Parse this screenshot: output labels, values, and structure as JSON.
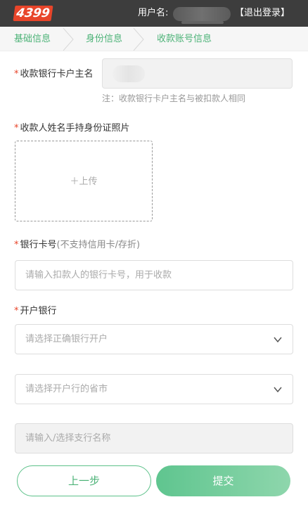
{
  "header": {
    "logo": "4399",
    "user_label": "用户名:",
    "logout": "【退出登录】"
  },
  "steps": [
    {
      "label": "基础信息"
    },
    {
      "label": "身份信息"
    },
    {
      "label": "收款账号信息"
    }
  ],
  "form": {
    "account_name": {
      "required_mark": "*",
      "label": "收款银行卡户主名",
      "note": "注：收款银行卡户主名与被扣款人相同"
    },
    "id_photo": {
      "required_mark": "*",
      "label": "收款人姓名手持身份证照片",
      "upload_text": "＋上传"
    },
    "bank_card": {
      "required_mark": "*",
      "label": "银行卡号",
      "sub_label": "(不支持信用卡/存折)",
      "placeholder": "请输入扣款人的银行卡号，用于收款"
    },
    "bank": {
      "required_mark": "*",
      "label": "开户银行",
      "select_placeholder": "请选择正确银行开户",
      "province_placeholder": "请选择开户行的省市",
      "branch_placeholder": "请输入/选择支行名称"
    }
  },
  "buttons": {
    "prev": "上一步",
    "submit": "提交"
  },
  "colors": {
    "accent": "#4db378",
    "required": "#e8452a",
    "header_bg": "#3d3d3d"
  }
}
